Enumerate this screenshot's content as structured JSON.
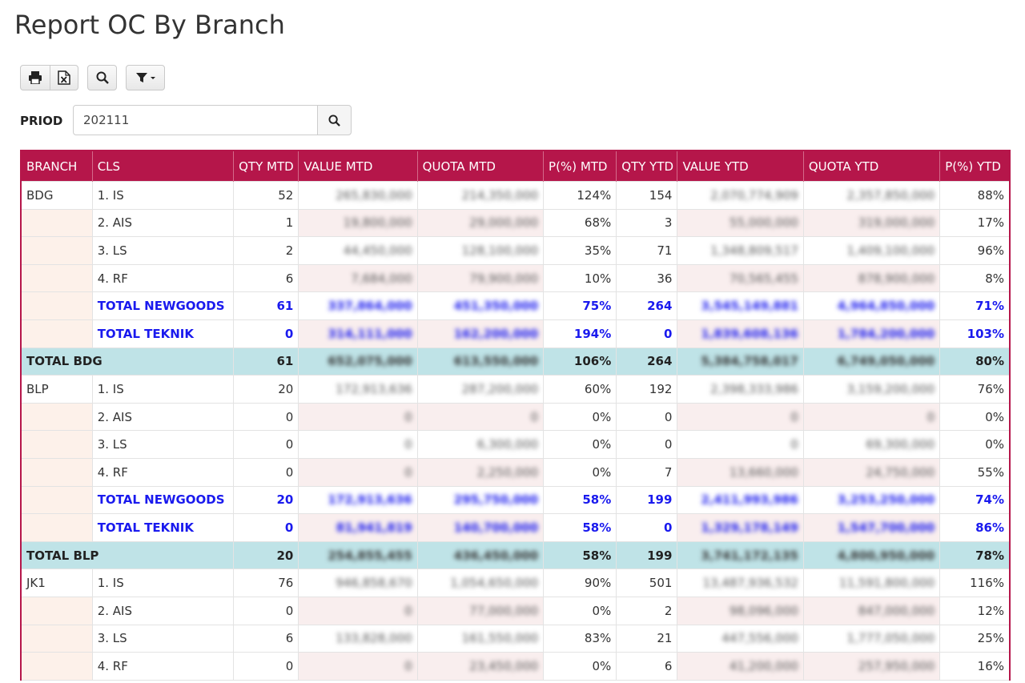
{
  "page": {
    "title": "Report OC By Branch"
  },
  "toolbar": {
    "buttons": [
      "print-icon",
      "excel-icon",
      "search-icon",
      "filter-icon"
    ]
  },
  "filter": {
    "label": "PRIOD",
    "value": "202111"
  },
  "table": {
    "headers": [
      "BRANCH",
      "CLS",
      "QTY MTD",
      "VALUE MTD",
      "QUOTA MTD",
      "P(%) MTD",
      "QTY YTD",
      "VALUE YTD",
      "QUOTA YTD",
      "P(%) YTD"
    ],
    "rows": [
      {
        "type": "row",
        "branch": "BDG",
        "cls": "1. IS",
        "qty_mtd": "52",
        "value_mtd": "265,830,000",
        "quota_mtd": "214,350,000",
        "p_mtd": "124%",
        "qty_ytd": "154",
        "value_ytd": "2,070,774,909",
        "quota_ytd": "2,357,850,000",
        "p_ytd": "88%"
      },
      {
        "type": "row",
        "branch": "",
        "cls": "2. AIS",
        "qty_mtd": "1",
        "value_mtd": "19,800,000",
        "quota_mtd": "29,000,000",
        "p_mtd": "68%",
        "qty_ytd": "3",
        "value_ytd": "55,000,000",
        "quota_ytd": "319,000,000",
        "p_ytd": "17%"
      },
      {
        "type": "row",
        "branch": "",
        "cls": "3. LS",
        "qty_mtd": "2",
        "value_mtd": "44,450,000",
        "quota_mtd": "128,100,000",
        "p_mtd": "35%",
        "qty_ytd": "71",
        "value_ytd": "1,348,809,517",
        "quota_ytd": "1,409,100,000",
        "p_ytd": "96%"
      },
      {
        "type": "row",
        "branch": "",
        "cls": "4. RF",
        "qty_mtd": "6",
        "value_mtd": "7,684,000",
        "quota_mtd": "79,900,000",
        "p_mtd": "10%",
        "qty_ytd": "36",
        "value_ytd": "70,565,455",
        "quota_ytd": "878,900,000",
        "p_ytd": "8%"
      },
      {
        "type": "sub",
        "branch": "",
        "cls": "TOTAL NEWGOODS",
        "qty_mtd": "61",
        "value_mtd": "337,864,000",
        "quota_mtd": "451,350,000",
        "p_mtd": "75%",
        "qty_ytd": "264",
        "value_ytd": "3,545,149,881",
        "quota_ytd": "4,964,850,000",
        "p_ytd": "71%"
      },
      {
        "type": "sub",
        "branch": "",
        "cls": "TOTAL TEKNIK",
        "qty_mtd": "0",
        "value_mtd": "314,111,000",
        "quota_mtd": "162,200,000",
        "p_mtd": "194%",
        "qty_ytd": "0",
        "value_ytd": "1,839,608,136",
        "quota_ytd": "1,784,200,000",
        "p_ytd": "103%"
      },
      {
        "type": "total",
        "branch": "TOTAL BDG",
        "cls": "",
        "qty_mtd": "61",
        "value_mtd": "652,075,000",
        "quota_mtd": "613,550,000",
        "p_mtd": "106%",
        "qty_ytd": "264",
        "value_ytd": "5,384,758,017",
        "quota_ytd": "6,749,050,000",
        "p_ytd": "80%"
      },
      {
        "type": "row",
        "branch": "BLP",
        "cls": "1. IS",
        "qty_mtd": "20",
        "value_mtd": "172,913,636",
        "quota_mtd": "287,200,000",
        "p_mtd": "60%",
        "qty_ytd": "192",
        "value_ytd": "2,398,333,986",
        "quota_ytd": "3,159,200,000",
        "p_ytd": "76%"
      },
      {
        "type": "row",
        "branch": "",
        "cls": "2. AIS",
        "qty_mtd": "0",
        "value_mtd": "0",
        "quota_mtd": "0",
        "p_mtd": "0%",
        "qty_ytd": "0",
        "value_ytd": "0",
        "quota_ytd": "0",
        "p_ytd": "0%"
      },
      {
        "type": "row",
        "branch": "",
        "cls": "3. LS",
        "qty_mtd": "0",
        "value_mtd": "0",
        "quota_mtd": "6,300,000",
        "p_mtd": "0%",
        "qty_ytd": "0",
        "value_ytd": "0",
        "quota_ytd": "69,300,000",
        "p_ytd": "0%"
      },
      {
        "type": "row",
        "branch": "",
        "cls": "4. RF",
        "qty_mtd": "0",
        "value_mtd": "0",
        "quota_mtd": "2,250,000",
        "p_mtd": "0%",
        "qty_ytd": "7",
        "value_ytd": "13,660,000",
        "quota_ytd": "24,750,000",
        "p_ytd": "55%"
      },
      {
        "type": "sub",
        "branch": "",
        "cls": "TOTAL NEWGOODS",
        "qty_mtd": "20",
        "value_mtd": "172,913,636",
        "quota_mtd": "295,750,000",
        "p_mtd": "58%",
        "qty_ytd": "199",
        "value_ytd": "2,411,993,986",
        "quota_ytd": "3,253,250,000",
        "p_ytd": "74%"
      },
      {
        "type": "sub",
        "branch": "",
        "cls": "TOTAL TEKNIK",
        "qty_mtd": "0",
        "value_mtd": "81,941,819",
        "quota_mtd": "140,700,000",
        "p_mtd": "58%",
        "qty_ytd": "0",
        "value_ytd": "1,329,178,149",
        "quota_ytd": "1,547,700,000",
        "p_ytd": "86%"
      },
      {
        "type": "total",
        "branch": "TOTAL BLP",
        "cls": "",
        "qty_mtd": "20",
        "value_mtd": "254,855,455",
        "quota_mtd": "436,450,000",
        "p_mtd": "58%",
        "qty_ytd": "199",
        "value_ytd": "3,741,172,135",
        "quota_ytd": "4,800,950,000",
        "p_ytd": "78%"
      },
      {
        "type": "row",
        "branch": "JK1",
        "cls": "1. IS",
        "qty_mtd": "76",
        "value_mtd": "946,858,670",
        "quota_mtd": "1,054,650,000",
        "p_mtd": "90%",
        "qty_ytd": "501",
        "value_ytd": "13,487,936,532",
        "quota_ytd": "11,591,800,000",
        "p_ytd": "116%"
      },
      {
        "type": "row",
        "branch": "",
        "cls": "2. AIS",
        "qty_mtd": "0",
        "value_mtd": "0",
        "quota_mtd": "77,000,000",
        "p_mtd": "0%",
        "qty_ytd": "2",
        "value_ytd": "98,096,000",
        "quota_ytd": "847,000,000",
        "p_ytd": "12%"
      },
      {
        "type": "row",
        "branch": "",
        "cls": "3. LS",
        "qty_mtd": "6",
        "value_mtd": "133,828,000",
        "quota_mtd": "161,550,000",
        "p_mtd": "83%",
        "qty_ytd": "21",
        "value_ytd": "447,556,000",
        "quota_ytd": "1,777,050,000",
        "p_ytd": "25%"
      },
      {
        "type": "row",
        "branch": "",
        "cls": "4. RF",
        "qty_mtd": "0",
        "value_mtd": "0",
        "quota_mtd": "23,450,000",
        "p_mtd": "0%",
        "qty_ytd": "6",
        "value_ytd": "41,200,000",
        "quota_ytd": "257,950,000",
        "p_ytd": "16%"
      }
    ]
  }
}
